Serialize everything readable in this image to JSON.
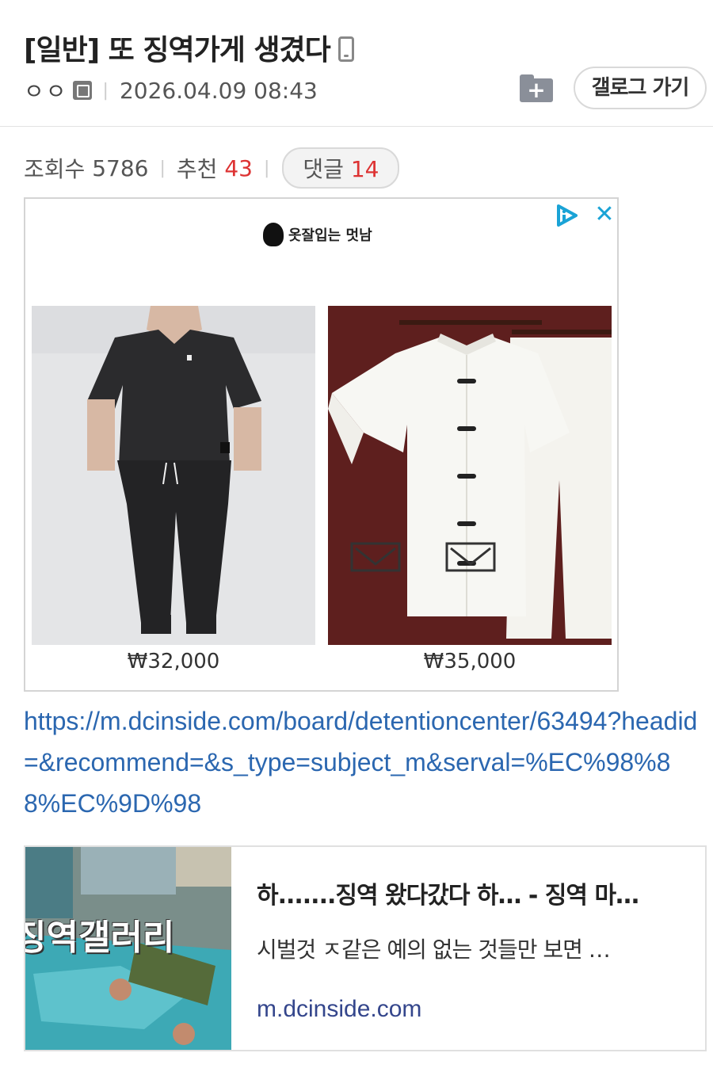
{
  "post": {
    "title": "[일반] 또 징역가게 생겼다",
    "device_icon": "mobile-phone-icon",
    "author": "ㅇㅇ",
    "author_badge_icon": "fixed-nick-badge-icon",
    "date": "2026.04.09 08:43",
    "folder_icon": "add-folder-icon",
    "gallery_button": "갤로그 가기"
  },
  "stats": {
    "views_label": "조회수",
    "views": "5786",
    "recommend_label": "추천",
    "recommend": "43",
    "comments_label": "댓글",
    "comments": "14"
  },
  "ad": {
    "brand": "옷잘입는 멋남",
    "adchoices_icon": "adchoices-icon",
    "close_icon": "close-icon",
    "products": [
      {
        "price": "₩32,000",
        "image": "black-shirt-and-jogger-set"
      },
      {
        "price": "₩35,000",
        "image": "white-mandarin-collar-shirt-and-pants-set"
      }
    ]
  },
  "link": {
    "url": "https://m.dcinside.com/board/detentioncenter/63494?headid=&recommend=&s_type=subject_m&serval=%EC%98%88%EC%9D%98"
  },
  "preview_card": {
    "thumb_text": "징역갤러리",
    "title": "하.......징역 왔다갔다 하…   - 징역 마…",
    "description": "시벌것 ㅈ같은 예의 없는 것들만 보면 …",
    "domain": "m.dcinside.com"
  },
  "colors": {
    "accent_red": "#dd3333",
    "link_blue": "#2b67b0",
    "ad_close": "#1aa3d6"
  }
}
